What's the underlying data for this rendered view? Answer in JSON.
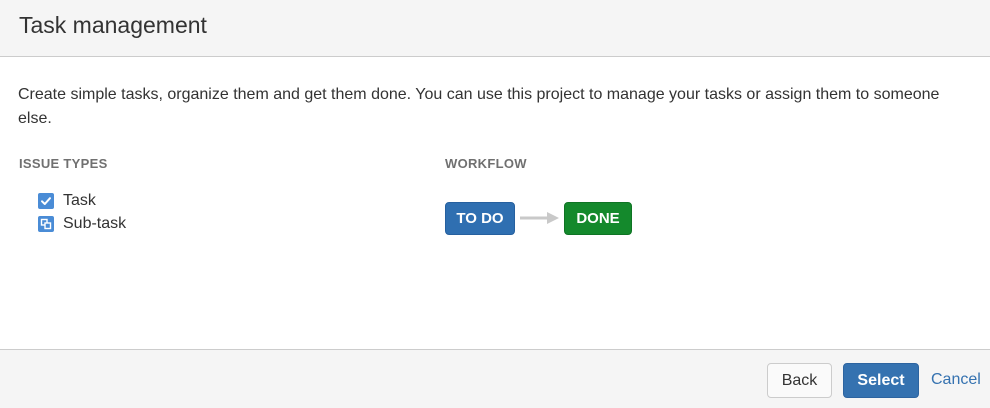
{
  "header": {
    "title": "Task management"
  },
  "description": "Create simple tasks, organize them and get them done. You can use this project to manage your tasks or assign them to someone else.",
  "issue_types": {
    "heading": "ISSUE TYPES",
    "items": [
      {
        "label": "Task",
        "icon": "task-checkbox-icon",
        "color": "#4a8cd6"
      },
      {
        "label": "Sub-task",
        "icon": "subtask-icon",
        "color": "#4a8cd6"
      }
    ]
  },
  "workflow": {
    "heading": "WORKFLOW",
    "statuses": [
      {
        "label": "TO DO",
        "color": "#2f6fb1"
      },
      {
        "label": "DONE",
        "color": "#14892c"
      }
    ],
    "arrow_icon": "arrow-right-icon"
  },
  "footer": {
    "back_label": "Back",
    "select_label": "Select",
    "cancel_label": "Cancel",
    "accent_color": "#3572b0"
  }
}
